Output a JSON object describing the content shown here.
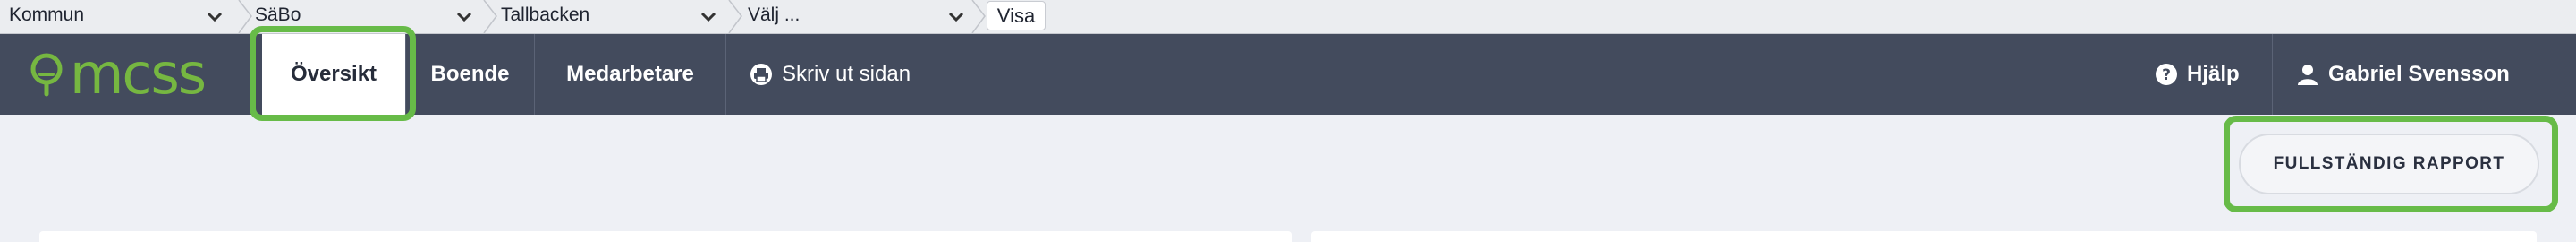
{
  "breadcrumbs": {
    "municipality": "Kommun",
    "unit_type": "SäBo",
    "unit": "Tallbacken",
    "select": "Välj ...",
    "show_button": "Visa"
  },
  "nav": {
    "logo_text": "mcss",
    "tabs": [
      {
        "label": "Översikt",
        "active": true
      },
      {
        "label": "Boende",
        "active": false
      },
      {
        "label": "Medarbetare",
        "active": false
      }
    ],
    "print_label": "Skriv ut sidan",
    "help_label": "Hjälp",
    "user_name": "Gabriel Svensson"
  },
  "content": {
    "report_button": "FULLSTÄNDIG RAPPORT"
  },
  "colors": {
    "navbar": "#434b5d",
    "highlight": "#67bb48",
    "logo_green": "#76b741"
  }
}
